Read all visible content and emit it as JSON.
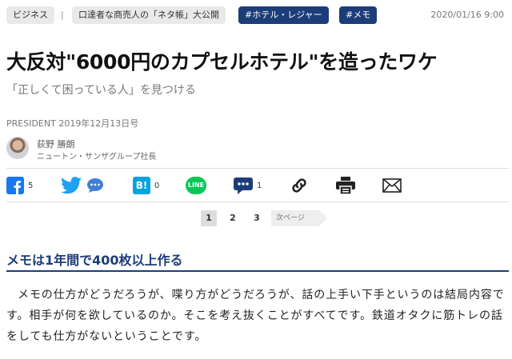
{
  "tags": {
    "category": "ビジネス",
    "series": "口達者な商売人の「ネタ帳」大公開",
    "tag1": "#ホテル・レジャー",
    "tag2": "#メモ",
    "separator": "|"
  },
  "date": "2020/01/16 9:00",
  "title": "大反対\"6000円のカプセルホテル\"を造ったワケ",
  "subtitle": "「正しくて困っている人」を見つける",
  "source": "PRESIDENT 2019年12月13日号",
  "author": {
    "name": "荻野 勝朗",
    "role": "ニュートン・サンザグループ社長"
  },
  "share": {
    "facebook_count": "5",
    "hatena_count": "0",
    "line_label": "LINE",
    "comment_count": "1",
    "hatena_label": "B!"
  },
  "pagination": {
    "pages": [
      "1",
      "2",
      "3"
    ],
    "current": "1",
    "next_label": "次ページ"
  },
  "section_heading": "メモは1年間で400枚以上作る",
  "paragraph": "メモの仕方がどうだろうが、喋り方がどうだろうが、話の上手い下手というのは結局内容です。相手が何を欲しているのか。そこを考え抜くことがすべてです。鉄道オタクに筋トレの話をしても仕方がないということです。",
  "colors": {
    "navy": "#1d3d78",
    "facebook": "#1877f2",
    "twitter": "#1da1f2",
    "hatena": "#00a4de",
    "line": "#06c755"
  }
}
